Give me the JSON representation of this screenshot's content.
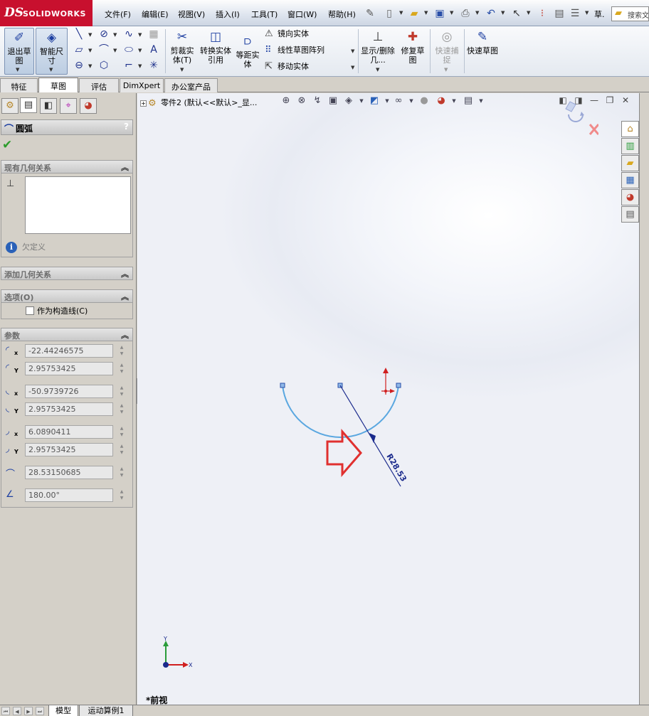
{
  "app": {
    "logo_mark": "DS",
    "logo_text": "SOLIDWORKS"
  },
  "menu": [
    {
      "id": "file",
      "label": "文件(F)"
    },
    {
      "id": "edit",
      "label": "编辑(E)"
    },
    {
      "id": "view",
      "label": "视图(V)"
    },
    {
      "id": "insert",
      "label": "插入(I)"
    },
    {
      "id": "tools",
      "label": "工具(T)"
    },
    {
      "id": "window",
      "label": "窗口(W)"
    },
    {
      "id": "help",
      "label": "帮助(H)"
    }
  ],
  "quick_access": {
    "more_label": "草.",
    "search_text": "搜索文"
  },
  "ribbon": {
    "exit_sketch": "退出草图",
    "smart_dimension": "智能尺寸",
    "trim_entities": "剪裁实体(T)",
    "convert_entities": "转换实体引用",
    "offset_entities": "等距实体",
    "mirror_entities": "镜向实体",
    "linear_pattern": "线性草图阵列",
    "move_entities": "移动实体",
    "display_delete_relations": "显示/删除几...",
    "repair_sketch": "修复草图",
    "quick_snaps": "快速捕捉",
    "rapid_sketch": "快速草图"
  },
  "cm_tabs": [
    {
      "id": "features",
      "label": "特征",
      "active": false
    },
    {
      "id": "sketch",
      "label": "草图",
      "active": true
    },
    {
      "id": "evaluate",
      "label": "评估",
      "active": false
    },
    {
      "id": "dimxpert",
      "label": "DimXpert",
      "active": false
    },
    {
      "id": "office",
      "label": "办公室产品",
      "active": false
    }
  ],
  "property_manager": {
    "title": "圆弧",
    "help": "?",
    "existing_relations": {
      "header": "现有几何关系",
      "status": "欠定义"
    },
    "add_relations": {
      "header": "添加几何关系"
    },
    "options": {
      "header": "选项(O)",
      "construction_label": "作为构造线(C)",
      "construction_checked": false
    },
    "parameters": {
      "header": "参数",
      "center_x": "-22.44246575",
      "center_y": "2.95753425",
      "start_x": "-50.9739726",
      "start_y": "2.95753425",
      "end_x": "6.0890411",
      "end_y": "2.95753425",
      "radius": "28.53150685",
      "angle": "180.00°"
    }
  },
  "graphics": {
    "tree_label": "零件2 (默认<<默认>_显...",
    "view_name": "*前视",
    "dimension_text": "R28.53",
    "axis_x_label": "X",
    "axis_y_label": "Y",
    "arc_color": "#5aa7e0",
    "dimension_color": "#1a2a8c",
    "arrow_color": "#e0302f",
    "background_highlight": "#ffffff"
  },
  "bottom_tabs": [
    {
      "id": "model",
      "label": "模型",
      "active": true
    },
    {
      "id": "motion",
      "label": "运动算例1",
      "active": false
    }
  ]
}
